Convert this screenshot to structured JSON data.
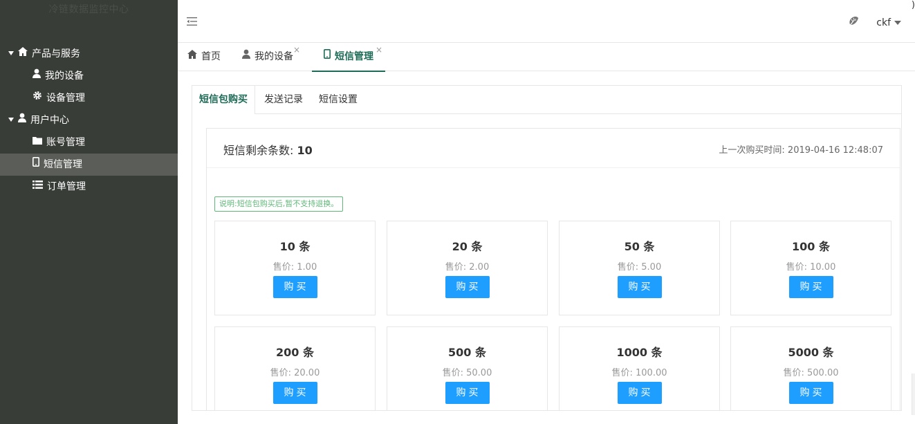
{
  "sidebar": {
    "brand": "冷链数据监控中心",
    "groups": [
      {
        "label": "产品与服务",
        "items": [
          "我的设备",
          "设备管理"
        ]
      },
      {
        "label": "用户中心",
        "items": [
          "账号管理",
          "短信管理",
          "订单管理"
        ]
      }
    ],
    "active_item": "短信管理"
  },
  "header": {
    "user": "ckf",
    "edge_glyph": ")"
  },
  "tabs": [
    {
      "label": "首页"
    },
    {
      "label": "我的设备",
      "close": "×"
    },
    {
      "label": "短信管理",
      "close": "×"
    }
  ],
  "subtabs": [
    "短信包购买",
    "发送记录",
    "短信设置"
  ],
  "summary": {
    "remaining_label": "短信剩余条数: ",
    "remaining_value": "10",
    "last_purchase": "上一次购买时间: 2019-04-16 12:48:07"
  },
  "notice": "说明:短信包购买后,暂不支持退换。",
  "packages": [
    {
      "title": "10 条",
      "price": "售价: 1.00",
      "button": "购买"
    },
    {
      "title": "20 条",
      "price": "售价: 2.00",
      "button": "购买"
    },
    {
      "title": "50 条",
      "price": "售价: 5.00",
      "button": "购买"
    },
    {
      "title": "100 条",
      "price": "售价: 10.00",
      "button": "购买"
    },
    {
      "title": "200 条",
      "price": "售价: 20.00",
      "button": "购买"
    },
    {
      "title": "500 条",
      "price": "售价: 50.00",
      "button": "购买"
    },
    {
      "title": "1000 条",
      "price": "售价: 100.00",
      "button": "购买"
    },
    {
      "title": "5000 条",
      "price": "售价: 500.00",
      "button": "购买"
    }
  ],
  "colors": {
    "sidebar_bg": "#393d38",
    "accent": "#1d6b56",
    "button": "#1e9fff",
    "notice": "#5fb878"
  }
}
